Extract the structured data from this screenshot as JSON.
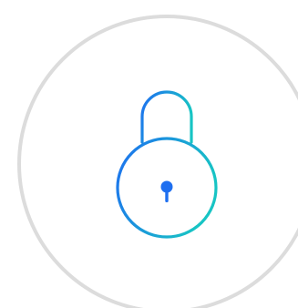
{
  "lock_screen": {
    "icon": "lock-icon",
    "ring_color": "#dcdcdc",
    "gradient": {
      "start": "#1e6ff0",
      "end": "#17c4c4"
    },
    "keyhole_color": "#1e6ff0",
    "state": "locked"
  }
}
